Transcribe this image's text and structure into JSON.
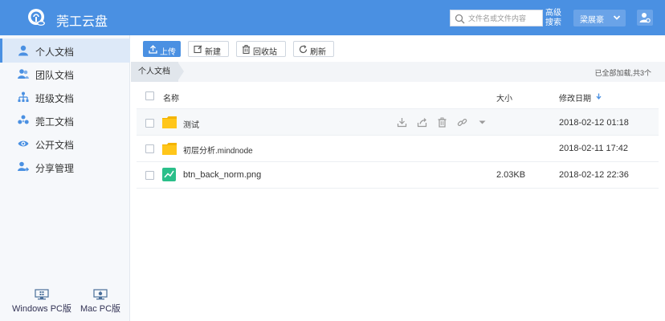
{
  "header": {
    "app_title": "莞工云盘",
    "search_placeholder": "文件名或文件内容",
    "advanced_search_line1": "高级",
    "advanced_search_line2": "搜索",
    "username": "梁展豪",
    "brand_color": "#4a90e2"
  },
  "sidebar": {
    "items": [
      {
        "label": "个人文档",
        "icon": "user-icon",
        "active": true
      },
      {
        "label": "团队文档",
        "icon": "team-icon"
      },
      {
        "label": "班级文档",
        "icon": "org-chart-icon"
      },
      {
        "label": "莞工文档",
        "icon": "group-icon"
      },
      {
        "label": "公开文档",
        "icon": "eye-icon"
      },
      {
        "label": "分享管理",
        "icon": "share-icon"
      }
    ],
    "clients": [
      {
        "label": "Windows PC版",
        "icon": "windows-monitor-icon"
      },
      {
        "label": "Mac PC版",
        "icon": "mac-monitor-icon"
      }
    ]
  },
  "toolbar": {
    "upload_label": "上传",
    "new_label": "新建",
    "recycle_label": "回收站",
    "refresh_label": "刷新"
  },
  "breadcrumb": {
    "current": "个人文档",
    "loaded_info": "已全部加载,共3个"
  },
  "table": {
    "col_name": "名称",
    "col_size": "大小",
    "col_modified": "修改日期",
    "rows": [
      {
        "name": "测试",
        "type": "folder",
        "size": "",
        "modified": "2018-02-12 01:18"
      },
      {
        "name": "初层分析.mindnode",
        "type": "folder",
        "size": "",
        "modified": "2018-02-11 17:42"
      },
      {
        "name": "btn_back_norm.png",
        "type": "image",
        "size": "2.03KB",
        "modified": "2018-02-12 22:36"
      }
    ]
  }
}
